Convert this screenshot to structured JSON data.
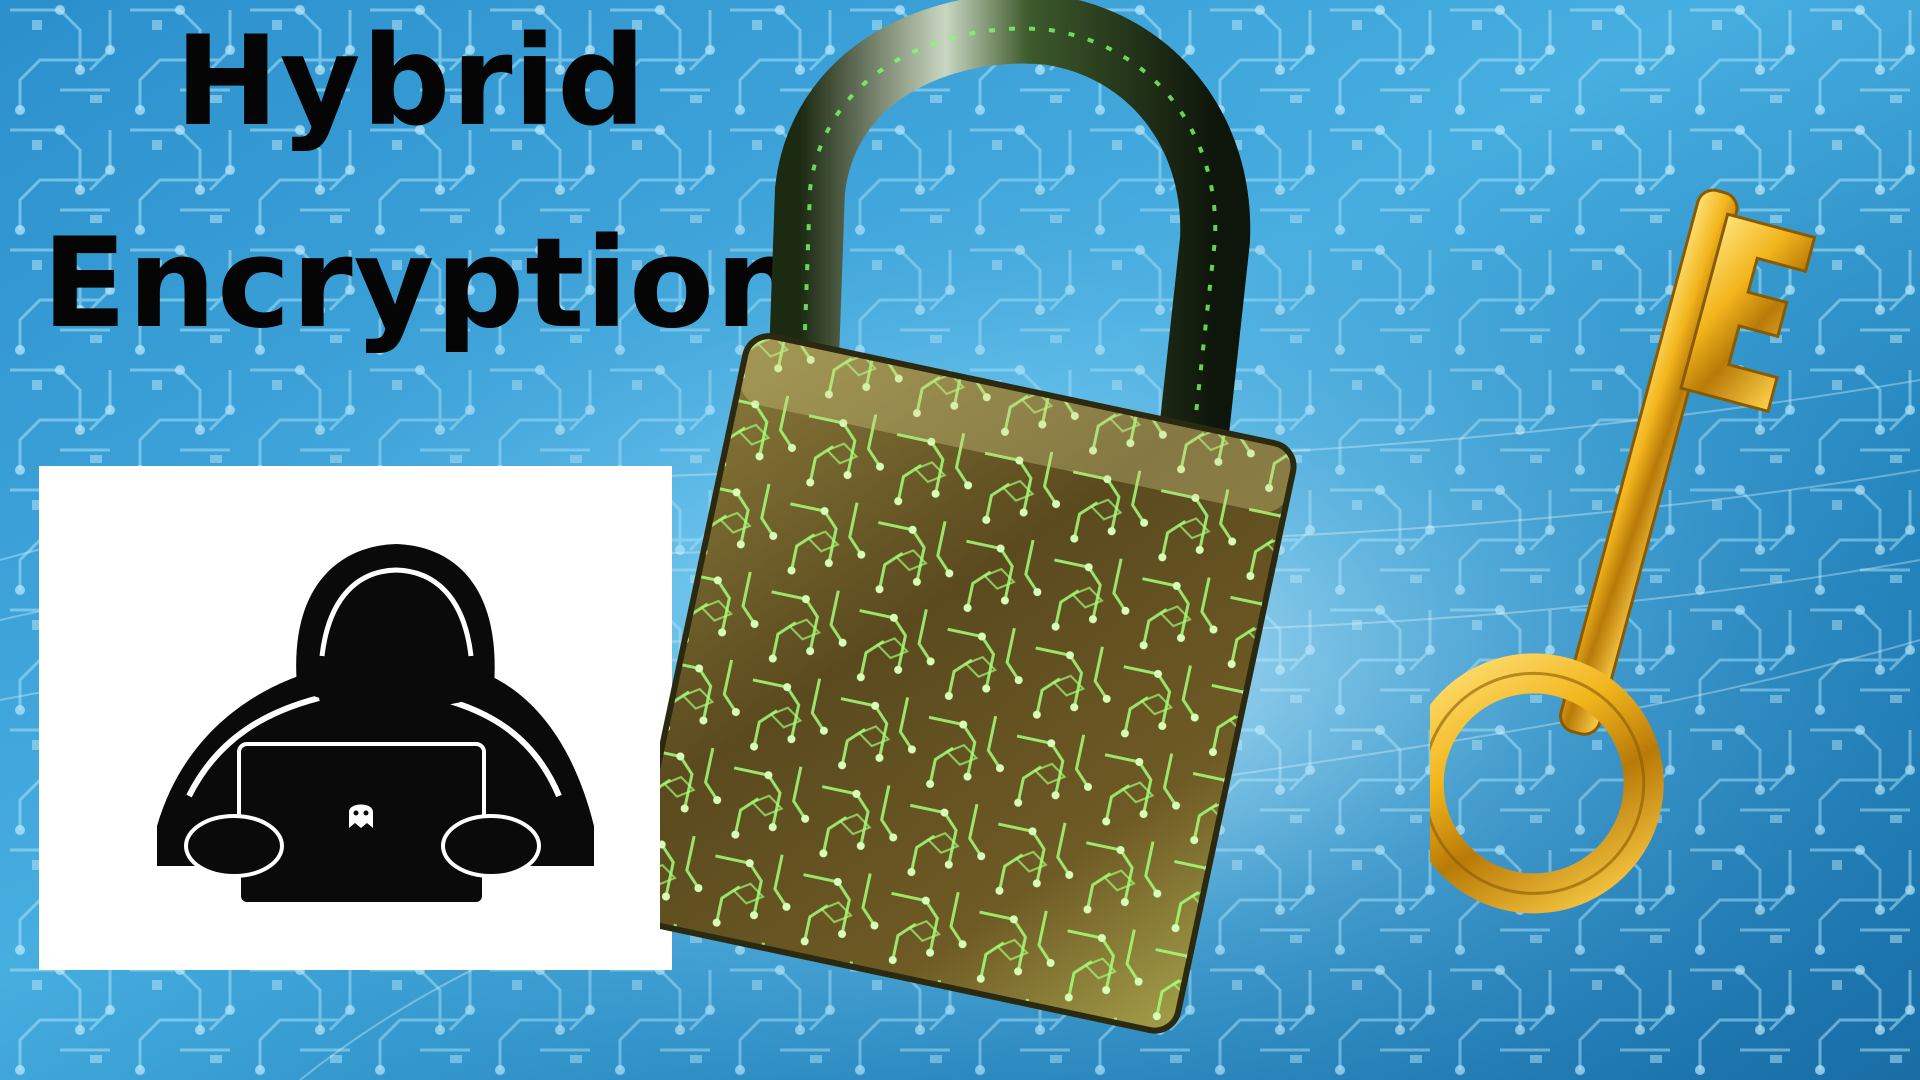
{
  "title": {
    "line1": "Hybrid",
    "line2": "Encryption"
  },
  "illustrations": {
    "background": "circuit-board-pattern",
    "padlock": "padlock-icon",
    "key": "golden-key-icon",
    "hacker": "hooded-hacker-with-laptop-icon"
  },
  "colors": {
    "background_blue": "#1f7fb8",
    "circuit_light": "#9fdcf5",
    "title_text": "#050505",
    "padlock_body": "#5a4a1e",
    "circuit_glow": "#7dff6a",
    "key_gold": "#f2b51c",
    "panel_white": "#ffffff",
    "hacker_black": "#0a0a0a"
  }
}
